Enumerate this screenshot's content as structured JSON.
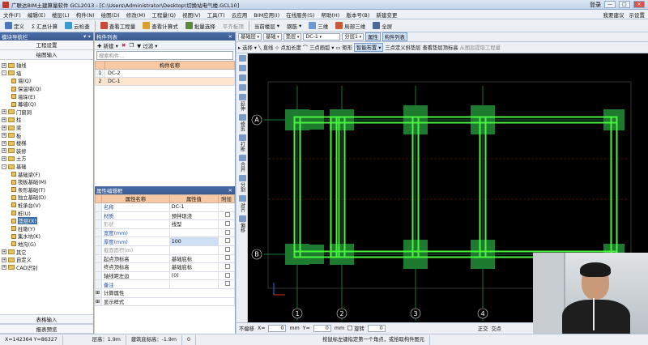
{
  "window": {
    "title": "广联达BIM土建算量软件 GCL2013 - [C:\\Users\\Administrator\\Desktop\\切换站电气楼.GCL10]",
    "login_label": "登录",
    "minimize": "—",
    "restore": "□",
    "close": "×"
  },
  "menu": {
    "items": [
      "文件(F)",
      "编辑(E)",
      "楼层(L)",
      "构件(N)",
      "绘图(D)",
      "修改(M)",
      "工程量(Q)",
      "视图(V)",
      "工具(T)",
      "云应用",
      "BIM应用(I)",
      "在线服务(S)",
      "帮助(H)",
      "版本号(B)",
      "新建变更"
    ],
    "right": [
      "我要建议",
      "示设置"
    ]
  },
  "toolbar1": {
    "items": [
      "定义",
      "Σ 汇总计算",
      "云检查",
      "查看工程量",
      "查看计算式",
      "批量选择",
      "平齐板顶",
      "当前楼层",
      "钢筋",
      "三维",
      "局部三维",
      "全屏"
    ]
  },
  "left_panel": {
    "title": "模块导航栏",
    "buttons": [
      "工程设置",
      "绘图输入"
    ],
    "tree": [
      {
        "label": "轴线",
        "level": 0,
        "type": "folder",
        "exp": "+"
      },
      {
        "label": "墙",
        "level": 0,
        "type": "folder",
        "exp": "-"
      },
      {
        "label": "墙(Q)",
        "level": 1,
        "type": "leaf"
      },
      {
        "label": "保温墙(Q)",
        "level": 1,
        "type": "leaf"
      },
      {
        "label": "墙垛(E)",
        "level": 1,
        "type": "leaf"
      },
      {
        "label": "幕墙(Q)",
        "level": 1,
        "type": "leaf"
      },
      {
        "label": "门窗洞",
        "level": 0,
        "type": "folder",
        "exp": "+"
      },
      {
        "label": "柱",
        "level": 0,
        "type": "folder",
        "exp": "+"
      },
      {
        "label": "梁",
        "level": 0,
        "type": "folder",
        "exp": "+"
      },
      {
        "label": "板",
        "level": 0,
        "type": "folder",
        "exp": "+"
      },
      {
        "label": "楼梯",
        "level": 0,
        "type": "folder",
        "exp": "+"
      },
      {
        "label": "装修",
        "level": 0,
        "type": "folder",
        "exp": "+"
      },
      {
        "label": "土方",
        "level": 0,
        "type": "folder",
        "exp": "+"
      },
      {
        "label": "基础",
        "level": 0,
        "type": "folder",
        "exp": "-"
      },
      {
        "label": "基础梁(F)",
        "level": 1,
        "type": "leaf"
      },
      {
        "label": "筏板基础(M)",
        "level": 1,
        "type": "leaf"
      },
      {
        "label": "条形基础(T)",
        "level": 1,
        "type": "leaf"
      },
      {
        "label": "独立基础(D)",
        "level": 1,
        "type": "leaf"
      },
      {
        "label": "桩承台(V)",
        "level": 1,
        "type": "leaf"
      },
      {
        "label": "桩(U)",
        "level": 1,
        "type": "leaf"
      },
      {
        "label": "垫层(X)",
        "level": 1,
        "type": "leaf",
        "selected": true
      },
      {
        "label": "柱墩(Y)",
        "level": 1,
        "type": "leaf"
      },
      {
        "label": "集水坑(K)",
        "level": 1,
        "type": "leaf"
      },
      {
        "label": "地沟(G)",
        "level": 1,
        "type": "leaf"
      },
      {
        "label": "其它",
        "level": 0,
        "type": "folder",
        "exp": "+"
      },
      {
        "label": "自定义",
        "level": 0,
        "type": "folder",
        "exp": "+"
      },
      {
        "label": "CAD识别",
        "level": 0,
        "type": "folder",
        "exp": "+"
      }
    ],
    "bottom_buttons": [
      "表格输入",
      "报表预览"
    ]
  },
  "component_list": {
    "title": "构件列表",
    "new_label": "新建",
    "filter_label": "过滤",
    "search_placeholder": "搜索构件...",
    "header": "构件名称",
    "rows": [
      {
        "num": "1",
        "name": "DC-2"
      },
      {
        "num": "2",
        "name": "DC-1",
        "selected": true
      }
    ]
  },
  "property_panel": {
    "title": "属性编辑框",
    "headers": [
      "属性名称",
      "属性值",
      "附加"
    ],
    "rows": [
      {
        "name": "名称",
        "value": "DC-1",
        "name_color": "blue",
        "cb": false
      },
      {
        "name": "材质",
        "value": "预拌现浇",
        "name_color": "blue",
        "cb": true
      },
      {
        "name": "形状",
        "value": "线型",
        "name_color": "gray",
        "cb": true
      },
      {
        "name": "宽度(mm)",
        "value": "",
        "name_color": "blue",
        "cb": true
      },
      {
        "name": "厚度(mm)",
        "value": "100",
        "name_color": "blue",
        "cb": true,
        "hl": true
      },
      {
        "name": "截面面积(m)",
        "value": "",
        "name_color": "gray",
        "cb": true
      },
      {
        "name": "起点顶标高",
        "value": "基础底标",
        "name_color": "",
        "cb": true
      },
      {
        "name": "终点顶标高",
        "value": "基础底标",
        "name_color": "",
        "cb": true
      },
      {
        "name": "轴线距左边",
        "value": "(0)",
        "name_color": "",
        "cb": true
      },
      {
        "name": "备注",
        "value": "",
        "name_color": "blue",
        "cb": true
      },
      {
        "name": "计算属性",
        "value": "",
        "name_color": "",
        "cb": false,
        "exp": true
      },
      {
        "name": "显示样式",
        "value": "",
        "name_color": "",
        "cb": false,
        "exp": true
      }
    ]
  },
  "canvas_toolbar1": {
    "floor_label": "基础层",
    "type1": "基础",
    "type2": "垫层",
    "comp": "DC-1",
    "layer": "分层1",
    "property_btn": "属性",
    "list_btn": "构件列表"
  },
  "canvas_toolbar2": {
    "items": [
      "选择",
      "直线",
      "点加长度",
      "三点画弧",
      "矩形",
      "智能布置",
      "三点定义斜垫层",
      "查看垫层顶标高",
      "从图层提取工程量"
    ]
  },
  "vertical_toolbar": {
    "items": [
      "延伸",
      "修剪",
      "打断",
      "合并",
      "分割",
      "对齐",
      "偏移"
    ]
  },
  "drawing": {
    "axis_rows": [
      "A",
      "B"
    ],
    "axis_cols": [
      "1",
      "2",
      "3",
      "4"
    ],
    "axis_color": "#1ea84a",
    "beam_color": "#47f53a",
    "pad_color": "#1e7a2e",
    "grid_color": "#8a1a1a"
  },
  "canvas_status": {
    "snap_label": "不偏移",
    "x_label": "X=",
    "x_value": "0",
    "x_unit": "mm",
    "y_label": "Y=",
    "y_value": "0",
    "y_unit": "mm",
    "rotate_label": "旋转",
    "rotate_value": "0",
    "ortho_label": "正交",
    "intersect_label": "交点"
  },
  "statusbar": {
    "coords": "X=142364 Y=86327",
    "floor_height": "层高：1.9m",
    "base_elev": "建筑底标高：-1.9m",
    "zero": "0",
    "hint": "按鼠标左键指定第一个角点，或拾取构件图元"
  }
}
